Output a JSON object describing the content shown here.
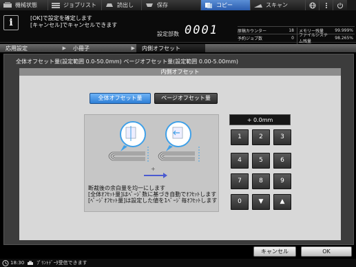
{
  "tabs": [
    {
      "label": "機械状態",
      "icon": "machine-status-icon"
    },
    {
      "label": "ジョブリスト",
      "icon": "job-list-icon"
    },
    {
      "label": "読出し",
      "icon": "recall-icon"
    },
    {
      "label": "保存",
      "icon": "save-icon"
    },
    {
      "label": "コピー",
      "icon": "copy-icon",
      "active": true
    },
    {
      "label": "スキャン",
      "icon": "scan-icon"
    }
  ],
  "message": {
    "line1": "[OK]で設定を確定します",
    "line2": "[キャンセル]でキャンセルできます"
  },
  "copies": {
    "label": "設定部数",
    "value": "0001"
  },
  "status": {
    "original_counter_label": "原稿カウンター",
    "original_counter_value": "18",
    "memory_label": "メモリー残量",
    "memory_value": "99.999%",
    "reserved_job_label": "予約ジョブ数",
    "reserved_job_value": "0",
    "filesystem_label": "ファイルシステム残量",
    "filesystem_value": "98.265%"
  },
  "breadcrumb": [
    "応用設定",
    "小冊子",
    "内側オフセット"
  ],
  "range_text": "全体オフセット量(設定範囲 0.0-50.0mm)  ページオフセット量(設定範囲 0.00-5.00mm)",
  "panel_title": "内側オフセット",
  "mode_buttons": {
    "all": "全体オフセット量",
    "page": "ページオフセット量"
  },
  "value_display": "+  0.0mm",
  "keypad": [
    "1",
    "2",
    "3",
    "4",
    "5",
    "6",
    "7",
    "8",
    "9",
    "0",
    "▼",
    "▲"
  ],
  "description": [
    "断裁後の余白量を均一にします",
    "[全体ｵﾌｾｯﾄ量]はﾍﾟｰｼﾞ数に基づき自動でｵﾌｾｯﾄします",
    "[ﾍﾟｰｼﾞｵﾌｾｯﾄ量]は設定した値を1ﾍﾟｰｼﾞ毎ｵﾌｾｯﾄします"
  ],
  "plus_sign": "+",
  "buttons": {
    "cancel": "キャンセル",
    "ok": "OK"
  },
  "footer": {
    "time": "18:30",
    "status": "ﾌﾟﾘﾝﾄﾃﾞｰﾀ受信できます"
  },
  "colors": {
    "accent": "#2e7fd6",
    "active_tab": "#2a5cae"
  }
}
